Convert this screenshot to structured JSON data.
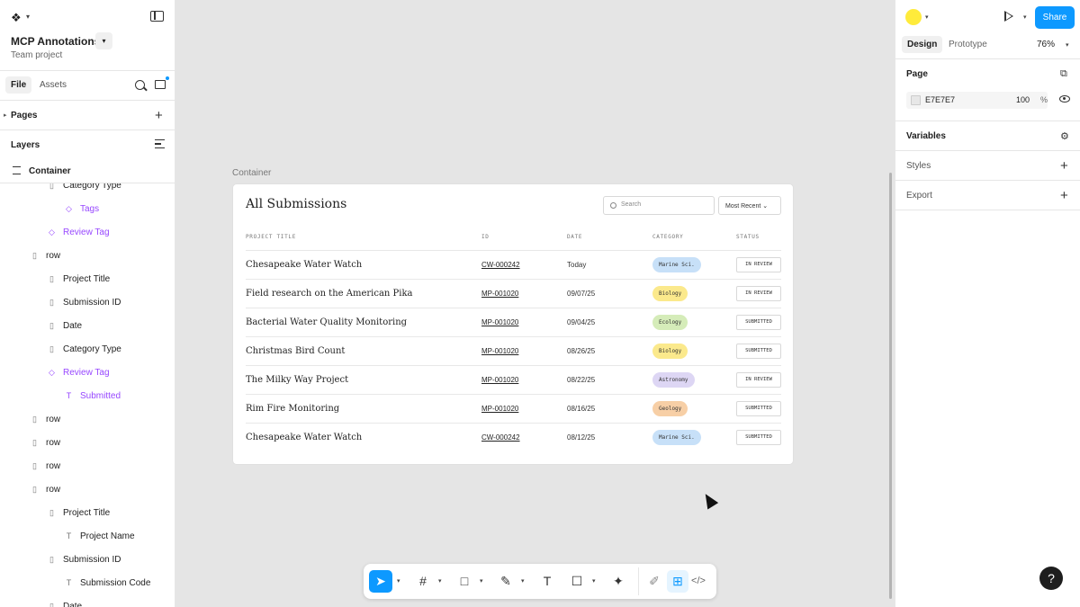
{
  "left_panel": {
    "file_name": "MCP Annotations",
    "team": "Team project",
    "tabs": {
      "file": "File",
      "assets": "Assets"
    },
    "pages_label": "Pages",
    "layers_label": "Layers",
    "root_layer": "Container",
    "tree": [
      {
        "label": "Category Type",
        "icon": "frame-icon",
        "purple": false
      },
      {
        "label": "Tags",
        "icon": "component-instance-icon",
        "purple": true
      },
      {
        "label": "Review Tag",
        "icon": "component-instance-icon",
        "purple": true
      },
      {
        "label": "row",
        "icon": "frame-icon",
        "purple": false
      },
      {
        "label": "Project Title",
        "icon": "frame-icon",
        "purple": false
      },
      {
        "label": "Submission ID",
        "icon": "frame-icon",
        "purple": false
      },
      {
        "label": "Date",
        "icon": "frame-icon",
        "purple": false
      },
      {
        "label": "Category Type",
        "icon": "frame-icon",
        "purple": false
      },
      {
        "label": "Review Tag",
        "icon": "component-instance-icon",
        "purple": true
      },
      {
        "label": "Submitted",
        "icon": "text-icon",
        "purple": true
      },
      {
        "label": "row",
        "icon": "frame-icon",
        "purple": false
      },
      {
        "label": "row",
        "icon": "frame-icon",
        "purple": false
      },
      {
        "label": "row",
        "icon": "frame-icon",
        "purple": false
      },
      {
        "label": "row",
        "icon": "frame-icon",
        "purple": false
      },
      {
        "label": "Project Title",
        "icon": "frame-icon",
        "purple": false
      },
      {
        "label": "Project Name",
        "icon": "text-icon",
        "purple": false
      },
      {
        "label": "Submission ID",
        "icon": "frame-icon",
        "purple": false
      },
      {
        "label": "Submission Code",
        "icon": "text-icon",
        "purple": false
      },
      {
        "label": "Date",
        "icon": "frame-icon",
        "purple": false
      }
    ]
  },
  "canvas": {
    "frame_label": "Container",
    "card": {
      "title": "All Submissions",
      "search_placeholder": "Search",
      "sort_label": "Most Recent",
      "columns": [
        "PROJECT TITLE",
        "ID",
        "DATE",
        "CATEGORY",
        "STATUS"
      ],
      "rows": [
        {
          "title": "Chesapeake Water Watch",
          "id": "CW-000242",
          "date": "Today",
          "category": "Marine Sci.",
          "cat_color": "#c7e0f8",
          "status": "IN REVIEW"
        },
        {
          "title": "Field research on the American Pika",
          "id": "MP-001020",
          "date": "09/07/25",
          "category": "Biology",
          "cat_color": "#fbe98c",
          "status": "IN REVIEW"
        },
        {
          "title": "Bacterial Water Quality Monitoring",
          "id": "MP-001020",
          "date": "09/04/25",
          "category": "Ecology",
          "cat_color": "#d5ecb9",
          "status": "SUBMITTED"
        },
        {
          "title": "Christmas Bird Count",
          "id": "MP-001020",
          "date": "08/26/25",
          "category": "Biology",
          "cat_color": "#fbe98c",
          "status": "SUBMITTED"
        },
        {
          "title": "The Milky Way Project",
          "id": "MP-001020",
          "date": "08/22/25",
          "category": "Astronomy",
          "cat_color": "#ddd6f4",
          "status": "IN REVIEW"
        },
        {
          "title": "Rim Fire Monitoring",
          "id": "MP-001020",
          "date": "08/16/25",
          "category": "Geology",
          "cat_color": "#f7cfa6",
          "status": "SUBMITTED"
        },
        {
          "title": "Chesapeake Water Watch",
          "id": "CW-000242",
          "date": "08/12/25",
          "category": "Marine Sci.",
          "cat_color": "#c7e0f8",
          "status": "SUBMITTED"
        }
      ]
    }
  },
  "toolbar": {
    "tools": [
      "move-tool",
      "frame-tool",
      "shape-tool",
      "pen-tool",
      "text-tool",
      "comment-tool",
      "actions-tool",
      "draw-mode",
      "design-mode",
      "dev-mode"
    ],
    "accent": "#0d99ff"
  },
  "right_panel": {
    "tabs": {
      "design": "Design",
      "prototype": "Prototype"
    },
    "zoom": "76%",
    "share_label": "Share",
    "page_label": "Page",
    "page_color": "E7E7E7",
    "page_opacity": "100",
    "percent": "%",
    "variables_label": "Variables",
    "styles_label": "Styles",
    "export_label": "Export",
    "help": "?"
  }
}
